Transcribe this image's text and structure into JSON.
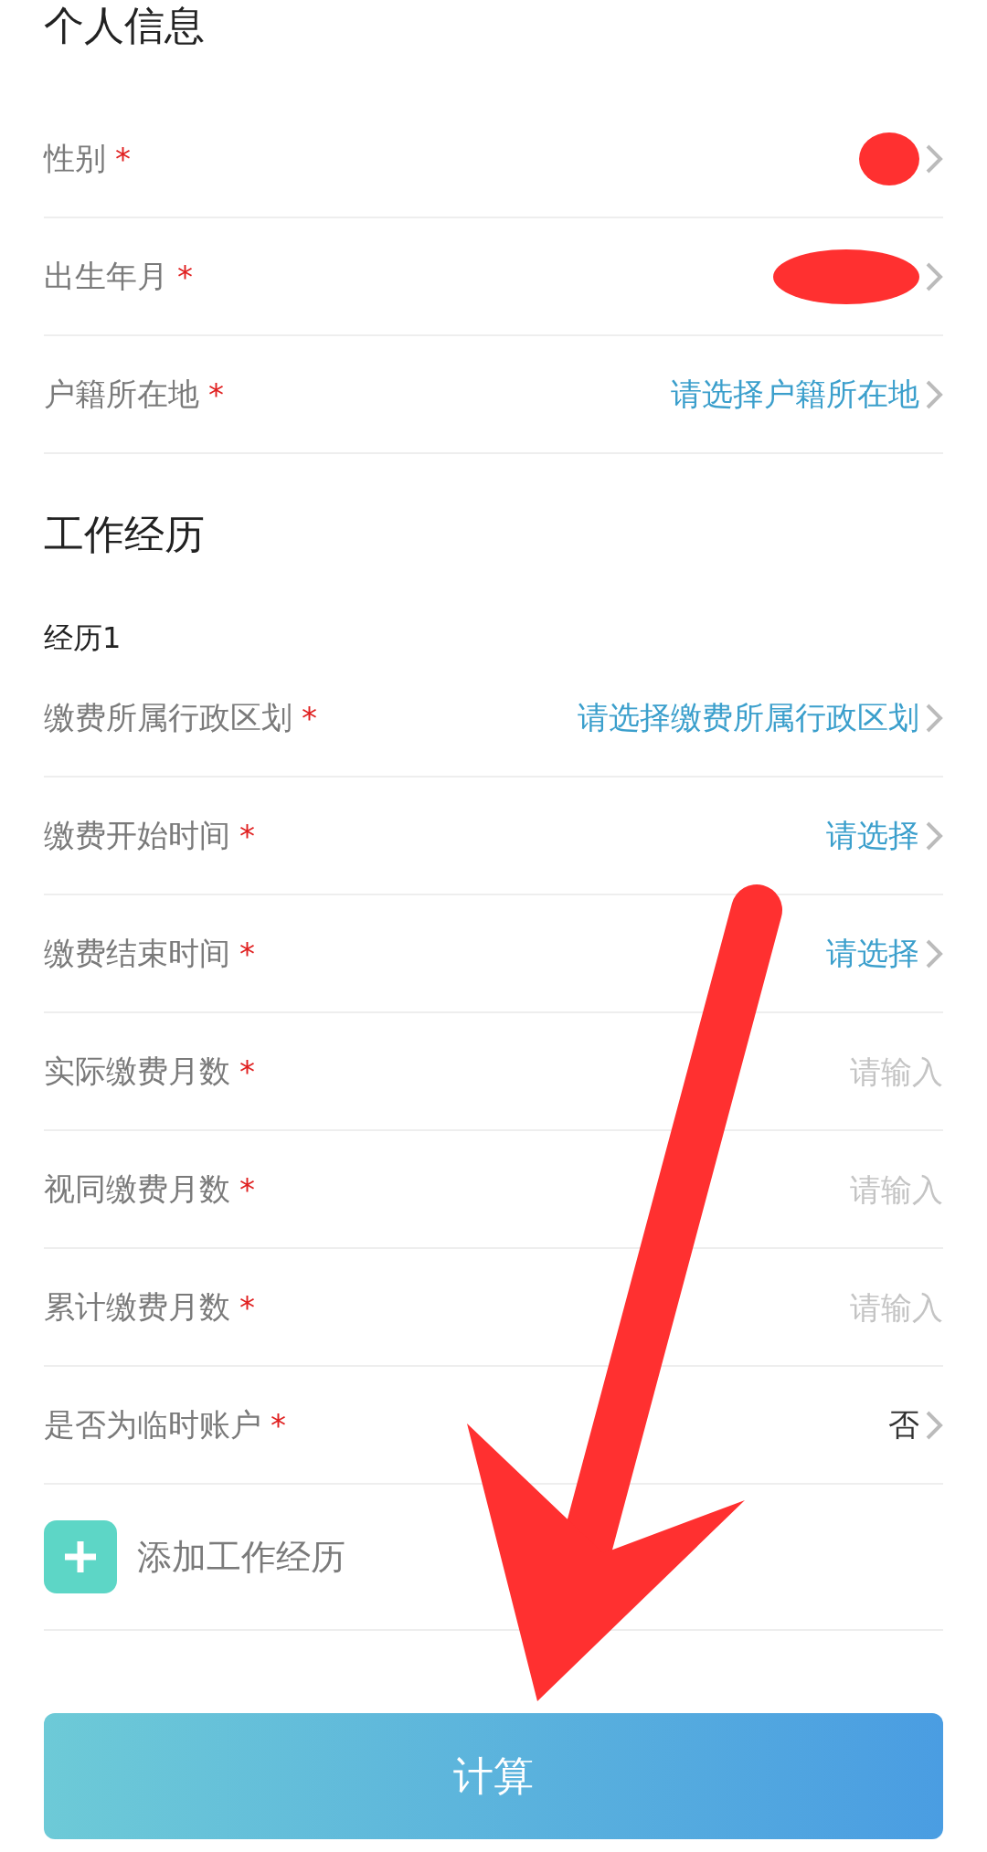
{
  "personal": {
    "title": "个人信息",
    "rows": [
      {
        "label": "性别",
        "mark": "*",
        "kind": "redacted"
      },
      {
        "label": "出生年月",
        "mark": "*",
        "kind": "redacted_wide"
      },
      {
        "label": "户籍所在地",
        "mark": "*",
        "kind": "select",
        "placeholder": "请选择户籍所在地"
      }
    ]
  },
  "work": {
    "title": "工作经历",
    "subtitle": "经历1",
    "rows": [
      {
        "label": "缴费所属行政区划",
        "mark": "*",
        "kind": "select",
        "placeholder": "请选择缴费所属行政区划"
      },
      {
        "label": "缴费开始时间",
        "mark": "*",
        "kind": "select",
        "placeholder": "请选择"
      },
      {
        "label": "缴费结束时间",
        "mark": "*",
        "kind": "select",
        "placeholder": "请选择"
      },
      {
        "label": "实际缴费月数",
        "mark": "*",
        "kind": "input",
        "placeholder": "请输入"
      },
      {
        "label": "视同缴费月数",
        "mark": "*",
        "kind": "input",
        "placeholder": "请输入"
      },
      {
        "label": "累计缴费月数",
        "mark": "*",
        "kind": "input",
        "placeholder": "请输入"
      },
      {
        "label": "是否为临时账户",
        "mark": "*",
        "kind": "value",
        "value": "否"
      }
    ],
    "add_label": "添加工作经历"
  },
  "button": "计算"
}
